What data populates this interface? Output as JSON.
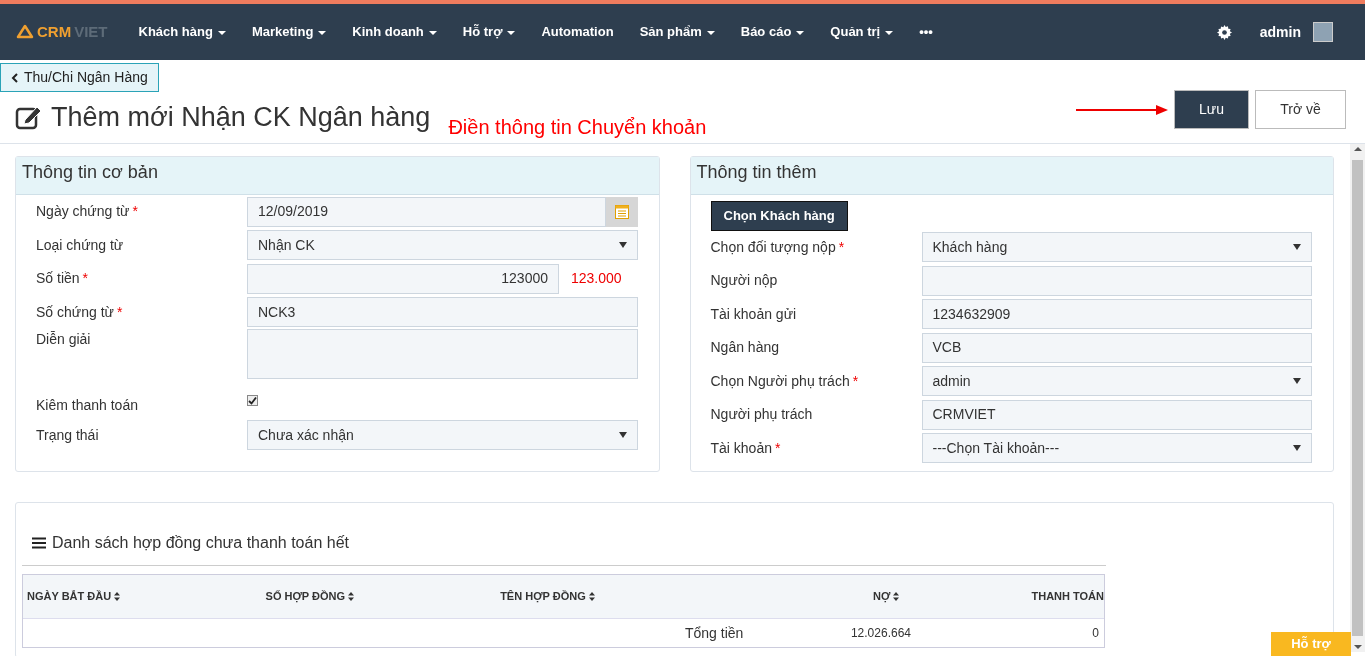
{
  "navbar": {
    "logo": {
      "part_1": "CRM",
      "part_2": "VIET"
    },
    "menu": [
      {
        "label": "Khách hàng",
        "dropdown": true
      },
      {
        "label": "Marketing",
        "dropdown": true
      },
      {
        "label": "Kinh doanh",
        "dropdown": true
      },
      {
        "label": "Hỗ trợ",
        "dropdown": true
      },
      {
        "label": "Automation",
        "dropdown": false
      },
      {
        "label": "Sản phẩm",
        "dropdown": true
      },
      {
        "label": "Báo cáo",
        "dropdown": true
      },
      {
        "label": "Quản trị",
        "dropdown": true
      },
      {
        "label": "•••",
        "dropdown": false
      }
    ],
    "user": "admin"
  },
  "back_link": "Thu/Chi Ngân Hàng",
  "page_title": "Thêm mới Nhận CK Ngân hàng",
  "annotation": "Điền thông tin Chuyển khoản",
  "buttons": [
    {
      "label": "Lưu",
      "kind": "primary"
    },
    {
      "label": "Trở về",
      "kind": "secondary"
    }
  ],
  "panels": [
    {
      "title": "Thông tin cơ bản",
      "fields": [
        {
          "label": "Ngày chứng từ",
          "required_mark": "*",
          "kind": "date",
          "value": "12/09/2019"
        },
        {
          "label": "Loại chứng từ",
          "kind": "select",
          "value": "Nhận CK"
        },
        {
          "label": "Số tiền",
          "required_mark": "*",
          "kind": "amount",
          "value": "123000",
          "formatted": "123.000"
        },
        {
          "label": "Số chứng từ",
          "required_mark": "*",
          "kind": "text",
          "value": "NCK3"
        },
        {
          "label": "Diễn giải",
          "kind": "textarea"
        },
        {
          "label": "Kiêm thanh toán",
          "kind": "checkbox",
          "checked": true
        },
        {
          "label": "Trạng thái",
          "kind": "select",
          "value": "Chưa xác nhận"
        }
      ]
    },
    {
      "title": "Thông tin thêm",
      "action_button": "Chọn Khách hàng",
      "fields": [
        {
          "label": "Chọn đối tượng nộp",
          "required_mark": "*",
          "kind": "select",
          "value": "Khách hàng"
        },
        {
          "label": "Người nộp",
          "kind": "text"
        },
        {
          "label": "Tài khoản gửi",
          "kind": "text",
          "value": "1234632909"
        },
        {
          "label": "Ngân hàng",
          "kind": "text",
          "value": "VCB"
        },
        {
          "label": "Chọn Người phụ trách",
          "required_mark": "*",
          "kind": "select",
          "value": "admin"
        },
        {
          "label": "Người phụ trách",
          "kind": "text",
          "value": "CRMVIET"
        },
        {
          "label": "Tài khoản",
          "required_mark": "*",
          "kind": "select",
          "value": "---Chọn Tài khoản---"
        }
      ]
    }
  ],
  "contracts": {
    "title": "Danh sách hợp đồng chưa thanh toán hết",
    "columns": [
      {
        "label": "NGÀY BẮT ĐẦU",
        "sortable": true
      },
      {
        "label": "SỐ HỢP ĐỒNG",
        "sortable": true
      },
      {
        "label": "TÊN HỢP ĐỒNG",
        "sortable": true
      },
      {
        "label": "NỢ",
        "sortable": true
      },
      {
        "label": "THANH TOÁN",
        "sortable": false
      }
    ],
    "total_row": {
      "label": "Tổng tiền",
      "debt": "12.026.664",
      "paid": "0"
    }
  },
  "help_button": "Hỗ trợ"
}
